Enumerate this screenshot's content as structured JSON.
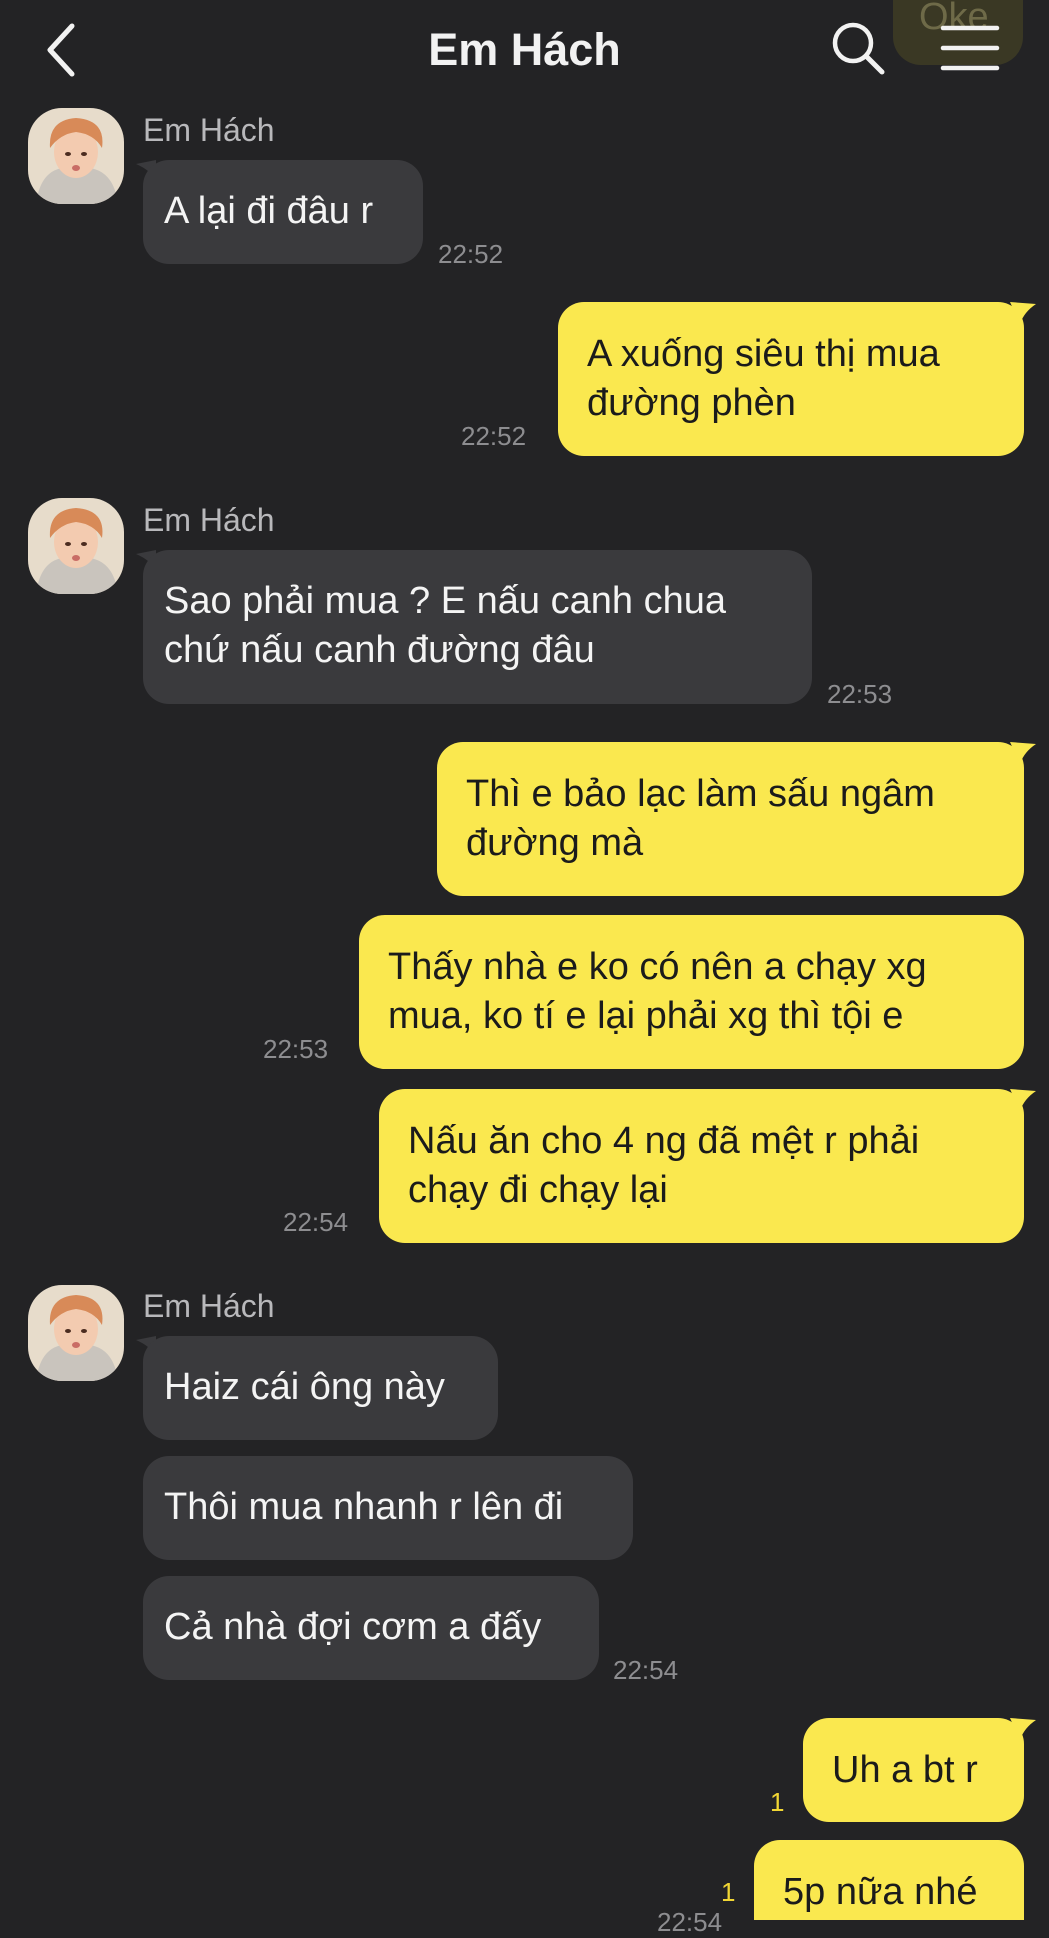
{
  "header": {
    "title": "Em Hách",
    "back_icon": "chevron-left-icon",
    "search_icon": "search-icon",
    "menu_icon": "hamburger-menu-icon",
    "peek_bubble_text": "Oke"
  },
  "colors": {
    "background": "#232325",
    "incoming_bubble": "#3a3a3d",
    "outgoing_bubble": "#fae84f",
    "timestamp": "#8d8d90",
    "unread_count": "#f1d634"
  },
  "messages": {
    "g1": {
      "sender": "Em Hách",
      "m1": "A lại đi đâu r",
      "time": "22:52"
    },
    "o1": {
      "line1": "A xuống siêu thị mua",
      "line2": "đường phèn",
      "time": "22:52"
    },
    "g2": {
      "sender": "Em Hách",
      "line1": "Sao phải mua ? E nấu canh chua",
      "line2": "chứ nấu canh đường đâu",
      "time": "22:53"
    },
    "o2": {
      "line1": "Thì e bảo lạc làm sấu ngâm",
      "line2": "đường mà"
    },
    "o3": {
      "line1": "Thấy nhà e ko có nên a chạy xg",
      "line2": "mua, ko tí e lại phải xg thì tội e",
      "time": "22:53"
    },
    "o4": {
      "line1": "Nấu ăn cho 4 ng đã mệt r phải",
      "line2": "chạy đi chạy lại",
      "time": "22:54"
    },
    "g3": {
      "sender": "Em Hách",
      "m1": "Haiz cái ông này",
      "m2": "Thôi mua nhanh r lên đi",
      "m3": "Cả nhà đợi cơm a đấy",
      "time": "22:54"
    },
    "o5": {
      "text": "Uh a bt r",
      "unread": "1"
    },
    "o6": {
      "text": "5p nữa nhé",
      "unread": "1",
      "time": "22:54"
    }
  }
}
